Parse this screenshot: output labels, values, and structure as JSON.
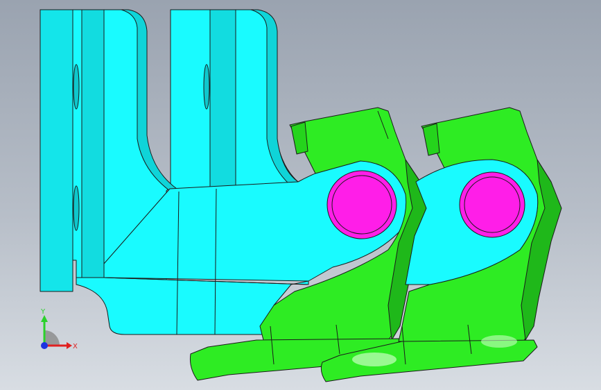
{
  "viewport": {
    "colors": {
      "cyan_part": "#19fbff",
      "cyan_dark": "#0fd4d8",
      "green_part": "#2eec23",
      "green_dark": "#1fb81a",
      "magenta_pin": "#ff1ee8",
      "edge": "#1a1a1a"
    }
  },
  "triad": {
    "y_label": "Y",
    "x_label": "X",
    "colors": {
      "y": "#2bd12b",
      "x": "#e02020",
      "z": "#1d34e0"
    }
  }
}
